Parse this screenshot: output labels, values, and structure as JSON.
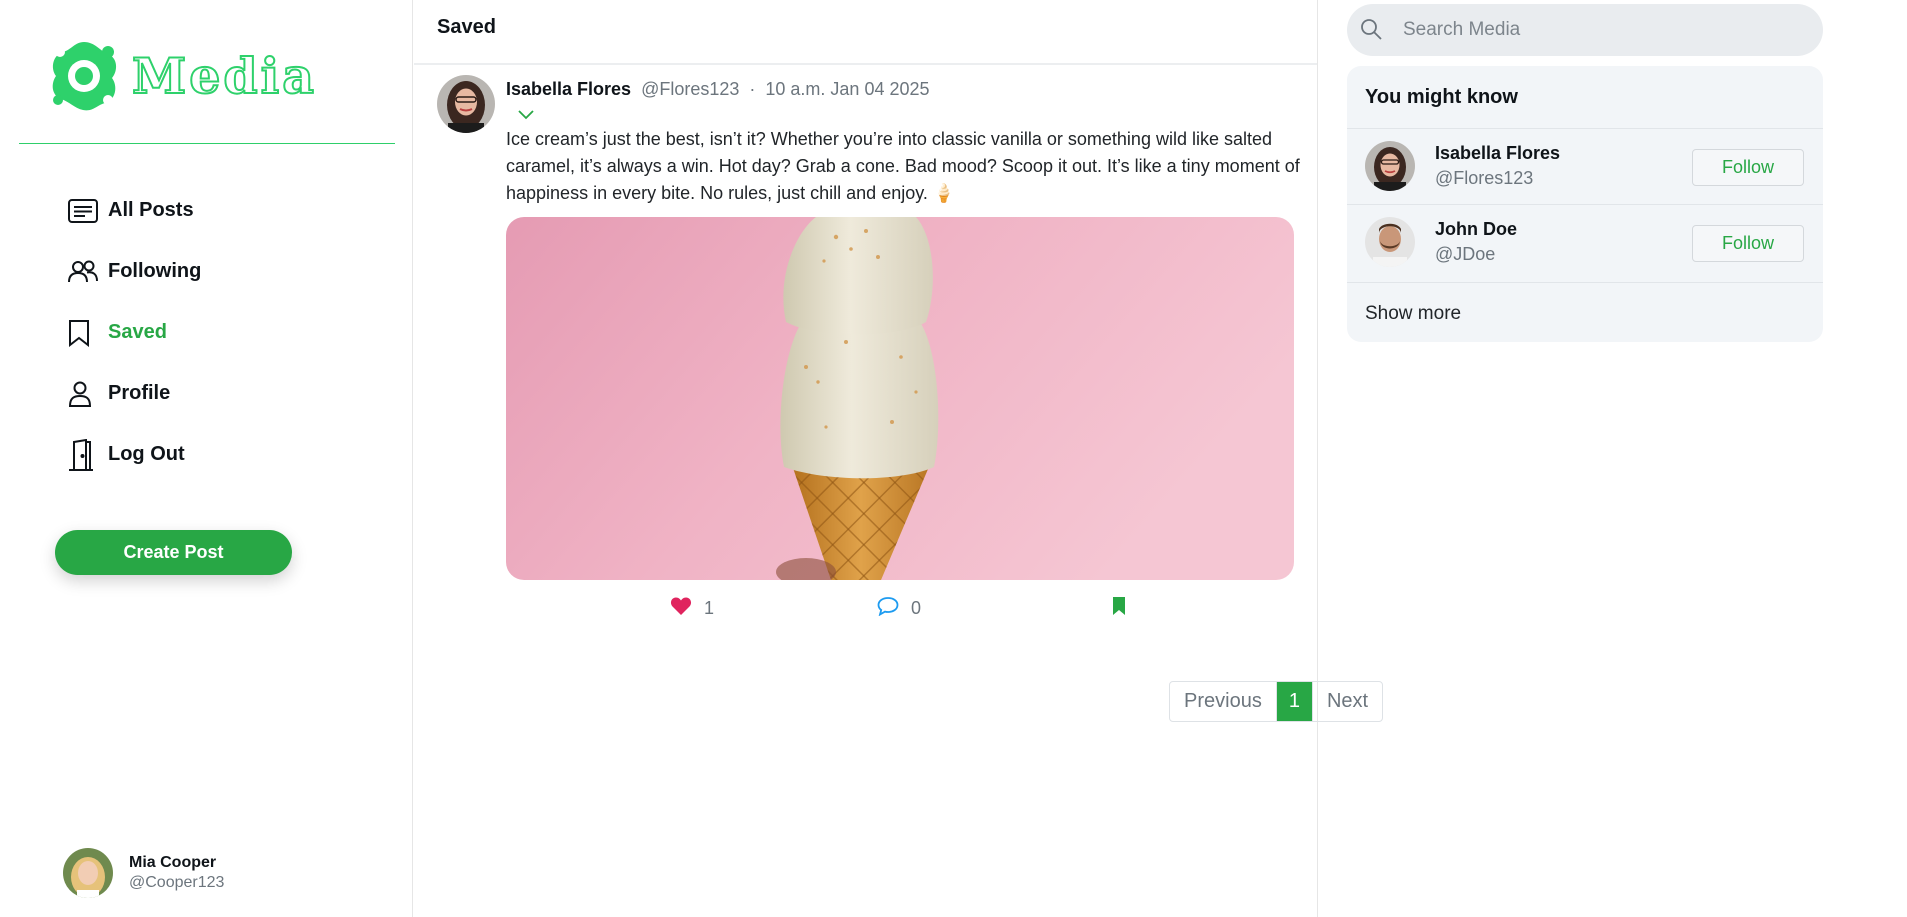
{
  "brand": {
    "name": "Media",
    "accent": "#28a745",
    "logo_color": "#2ed16b"
  },
  "sidebar": {
    "items": [
      {
        "label": "All Posts",
        "icon": "list-icon",
        "active": false
      },
      {
        "label": "Following",
        "icon": "users-icon",
        "active": false
      },
      {
        "label": "Saved",
        "icon": "bookmark-icon",
        "active": true
      },
      {
        "label": "Profile",
        "icon": "user-icon",
        "active": false
      },
      {
        "label": "Log Out",
        "icon": "door-icon",
        "active": false
      }
    ],
    "create_label": "Create Post",
    "current_user": {
      "name": "Mia Cooper",
      "handle": "@Cooper123"
    }
  },
  "main": {
    "title": "Saved",
    "post": {
      "author": "Isabella Flores",
      "handle": "@Flores123",
      "separator": "·",
      "time": "10 a.m. Jan 04 2025",
      "body": "Ice cream’s just the best, isn’t it? Whether you’re into classic vanilla or something wild like salted caramel, it’s always a win. Hot day? Grab a cone. Bad mood? Scoop it out. It’s like a tiny moment of happiness in every bite. No rules, just chill and enjoy. 🍦",
      "likes": "1",
      "comments": "0",
      "liked": true,
      "saved": true
    },
    "pagination": {
      "prev": "Previous",
      "current": "1",
      "next": "Next"
    }
  },
  "right": {
    "search": {
      "placeholder": "Search Media"
    },
    "suggestions": {
      "title": "You might know",
      "people": [
        {
          "name": "Isabella Flores",
          "handle": "@Flores123",
          "action": "Follow"
        },
        {
          "name": "John Doe",
          "handle": "@JDoe",
          "action": "Follow"
        }
      ],
      "show_more": "Show more"
    }
  }
}
